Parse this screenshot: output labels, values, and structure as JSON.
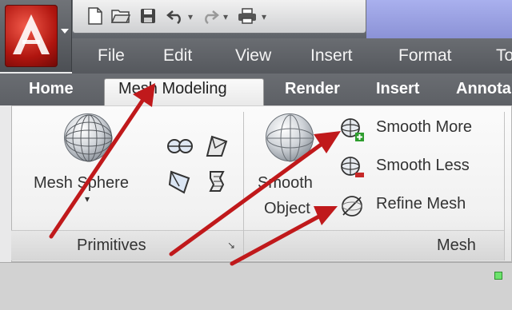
{
  "menu": {
    "items": [
      "File",
      "Edit",
      "View",
      "Insert",
      "Format",
      "To"
    ]
  },
  "tabs": {
    "home": "Home",
    "active": "Mesh Modeling",
    "render": "Render",
    "insert": "Insert",
    "annotate": "Annota"
  },
  "primitives_panel": {
    "mesh_sphere_label": "Mesh Sphere",
    "title": "Primitives"
  },
  "mesh_panel": {
    "smooth_object_line1": "Smooth",
    "smooth_object_line2": "Object",
    "smooth_more": "Smooth More",
    "smooth_less": "Smooth Less",
    "refine_mesh": "Refine Mesh",
    "title": "Mesh"
  },
  "colors": {
    "arrow": "#c0191b",
    "menu_bar": "#5f6368",
    "ribbon": "#f4f4f4"
  }
}
